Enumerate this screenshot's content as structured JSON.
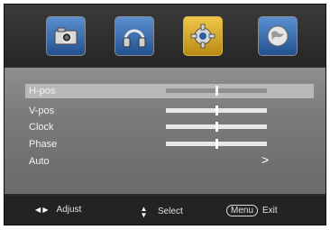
{
  "tabs": [
    {
      "icon": "camera-icon",
      "active": false
    },
    {
      "icon": "headphones-icon",
      "active": false
    },
    {
      "icon": "gear-icon",
      "active": true
    },
    {
      "icon": "globe-icon",
      "active": false
    }
  ],
  "menu": {
    "items": [
      {
        "label": "H-pos",
        "type": "slider",
        "value": 0.5,
        "selected": true
      },
      {
        "label": "V-pos",
        "type": "slider",
        "value": 0.5,
        "selected": false
      },
      {
        "label": "Clock",
        "type": "slider",
        "value": 0.5,
        "selected": false
      },
      {
        "label": "Phase",
        "type": "slider",
        "value": 0.5,
        "selected": false
      },
      {
        "label": "Auto",
        "type": "submenu",
        "arrow": ">",
        "selected": false
      }
    ]
  },
  "footer": {
    "adjust_icons": "◀ ▶",
    "adjust_label": "Adjust",
    "select_icons": "▲▼",
    "select_label": "Select",
    "menu_key": "Menu",
    "exit_label": "Exit"
  },
  "colors": {
    "panel": "#7f7f7f",
    "selection": "#b9b9b9",
    "active_tab": "#e0b030",
    "tab_blue": "#3d6fb0"
  }
}
